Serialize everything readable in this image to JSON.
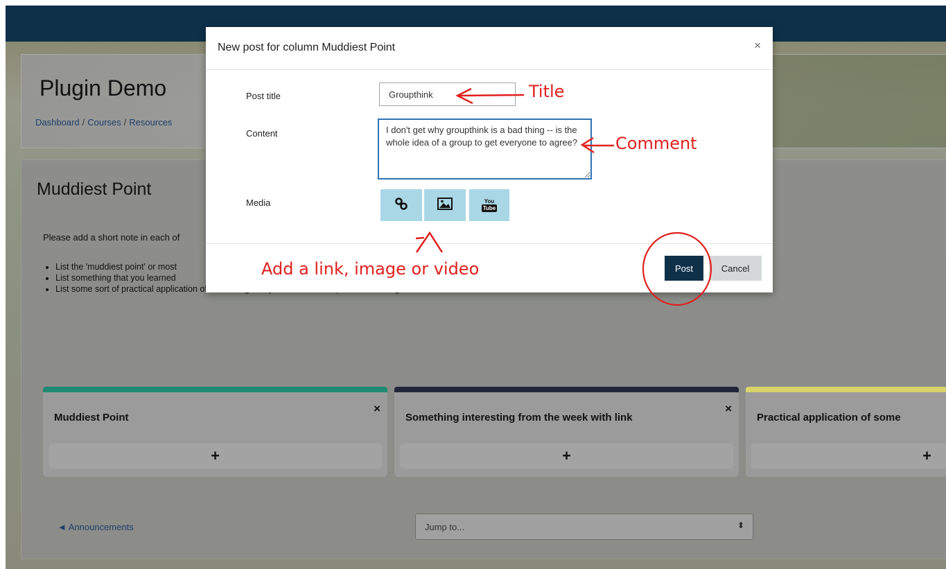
{
  "page": {
    "title": "Plugin Demo",
    "breadcrumb": [
      "Dashboard",
      "Courses",
      "Resources"
    ],
    "section_title": "Muddiest Point",
    "intro": "Please add a short note in each of",
    "bullets": [
      "List the 'muddiest point' or most",
      "List something that you learned",
      "List some sort of practical application of something that you learned for a person or an organization"
    ],
    "columns": [
      {
        "title": "Muddiest Point",
        "close": "×",
        "add": "+",
        "color": "#1f8a74"
      },
      {
        "title": "Something interesting from the week with link",
        "close": "×",
        "add": "+",
        "color": "#22253a"
      },
      {
        "title": "Practical application of some",
        "add": "+",
        "color": "#d9d36a"
      }
    ],
    "prev_link": "◄ Announcements",
    "jump_select": {
      "value": "Jump to...",
      "arrows": "⬍"
    }
  },
  "modal": {
    "title": "New post for column Muddiest Point",
    "close": "×",
    "post_title_label": "Post title",
    "post_title_value": "Groupthink",
    "content_label": "Content",
    "content_value": "I don't get why groupthink is a bad thing -- is the whole idea of a group to get everyone to agree?",
    "media_label": "Media",
    "media_buttons": [
      "link-icon",
      "image-icon",
      "youtube-icon"
    ],
    "youtube_you": "You",
    "youtube_tube": "Tube",
    "post_button": "Post",
    "cancel_button": "Cancel"
  },
  "annotations": {
    "title": "Title",
    "comment": "Comment",
    "media": "Add a link, image or video"
  },
  "colors": {
    "topbar": "#0e3049",
    "accent": "#0e3049",
    "media_button": "#a9d7e6",
    "annotation": "#e0201d",
    "focus_border": "#2d73b8"
  }
}
